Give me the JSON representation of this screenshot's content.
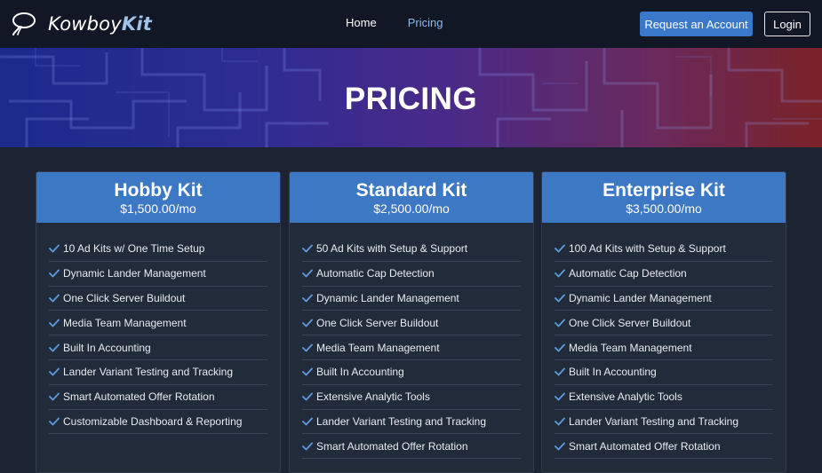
{
  "brand": {
    "name_prefix": "Kowboy",
    "name_suffix": "Kit"
  },
  "nav": {
    "links": [
      "Home",
      "Pricing"
    ],
    "active": "Pricing",
    "request_label": "Request an Account",
    "login_label": "Login"
  },
  "hero": {
    "title": "PRICING"
  },
  "colors": {
    "accent": "#3c78c4",
    "active_link": "#8fb8ec",
    "check": "#5d9be0"
  },
  "plans": [
    {
      "title": "Hobby Kit",
      "price": "$1,500.00/mo",
      "features": [
        "10 Ad Kits w/ One Time Setup",
        "Dynamic Lander Management",
        "One Click Server Buildout",
        "Media Team Management",
        "Built In Accounting",
        "Lander Variant Testing and Tracking",
        "Smart Automated Offer Rotation",
        "Customizable Dashboard & Reporting"
      ]
    },
    {
      "title": "Standard Kit",
      "price": "$2,500.00/mo",
      "features": [
        "50 Ad Kits with Setup & Support",
        "Automatic Cap Detection",
        "Dynamic Lander Management",
        "One Click Server Buildout",
        "Media Team Management",
        "Built In Accounting",
        "Extensive Analytic Tools",
        "Lander Variant Testing and Tracking",
        "Smart Automated Offer Rotation"
      ]
    },
    {
      "title": "Enterprise Kit",
      "price": "$3,500.00/mo",
      "features": [
        "100 Ad Kits with Setup & Support",
        "Automatic Cap Detection",
        "Dynamic Lander Management",
        "One Click Server Buildout",
        "Media Team Management",
        "Built In Accounting",
        "Extensive Analytic Tools",
        "Lander Variant Testing and Tracking",
        "Smart Automated Offer Rotation"
      ]
    }
  ]
}
